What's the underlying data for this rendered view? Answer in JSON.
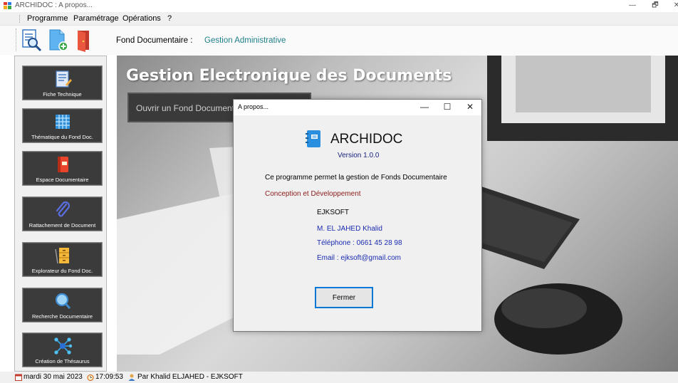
{
  "window": {
    "title": "ARCHIDOC : A propos...",
    "minimize_glyph": "—",
    "restore_glyph": "🗗",
    "close_glyph": "✕"
  },
  "menu": {
    "items": [
      {
        "label": "Programme"
      },
      {
        "label": "Paramétrage"
      },
      {
        "label": "Opérations"
      },
      {
        "label": "?"
      }
    ]
  },
  "toolbar": {
    "buttons": [
      {
        "icon": "document-search-icon"
      },
      {
        "icon": "new-document-icon"
      },
      {
        "icon": "exit-door-icon"
      }
    ],
    "fond_label": "Fond Documentaire :",
    "fond_value": "Gestion Administrative"
  },
  "sidebar": {
    "items": [
      {
        "label": "Fiche Technique",
        "icon": "notepad-icon"
      },
      {
        "label": "Thématique du Fond Doc.",
        "icon": "grid-table-icon"
      },
      {
        "label": "Espace Documentaire",
        "icon": "binder-icon"
      },
      {
        "label": "Rattachement de Document",
        "icon": "paperclip-icon"
      },
      {
        "label": "Explorateur du Fond Doc.",
        "icon": "filing-cabinet-icon"
      },
      {
        "label": "Recherche Documentaire",
        "icon": "magnifier-icon"
      },
      {
        "label": "Création de Thésaurus",
        "icon": "network-icon"
      }
    ]
  },
  "main": {
    "title": "Gestion Electronique des Documents",
    "open_button_label": "Ouvrir un Fond Documentaire"
  },
  "dialog": {
    "title": "A propos...",
    "minimize_glyph": "—",
    "maximize_glyph": "☐",
    "close_glyph": "✕",
    "app_name": "ARCHIDOC",
    "version": "Version 1.0.0",
    "description": "Ce programme permet la gestion de Fonds Documentaire",
    "conception_label": "Conception et Développement",
    "company": "EJKSOFT",
    "author": "M. EL JAHED Khalid",
    "phone": "Téléphone  : 0661 45 28 98",
    "email": "Email : ejksoft@gmail.com",
    "close_button": "Fermer"
  },
  "status": {
    "date": "mardi 30 mai 2023",
    "time": "17:09:53",
    "user": "Par Khalid ELJAHED - EJKSOFT"
  },
  "colors": {
    "accent": "#1f7f8a",
    "dialog_link": "#1a2bb0",
    "conception": "#8b1a1a",
    "nav_button_bg": "#3b3b3b"
  }
}
